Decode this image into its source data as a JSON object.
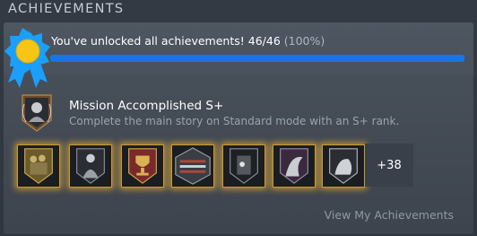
{
  "section": {
    "title": "ACHIEVEMENTS"
  },
  "summary": {
    "text": "You've unlocked all achievements! 46/46",
    "percent_text": "(100%)",
    "progress": 1.0
  },
  "featured": {
    "title": "Mission Accomplished S+",
    "description": "Complete the main story on Standard mode with an S+ rank."
  },
  "achievements": {
    "icons": [
      "soldier-group-icon",
      "hooded-figure-icon",
      "trophy-icon",
      "rifles-icon",
      "skull-door-icon",
      "wraith-icon",
      "creature-icon"
    ],
    "more_label": "+38"
  },
  "footer": {
    "link_label": "View My Achievements"
  },
  "colors": {
    "accent": "#1a73e8",
    "glow": "#e6aa32",
    "badge_blue": "#1a9fff",
    "badge_gold": "#f5c518"
  }
}
